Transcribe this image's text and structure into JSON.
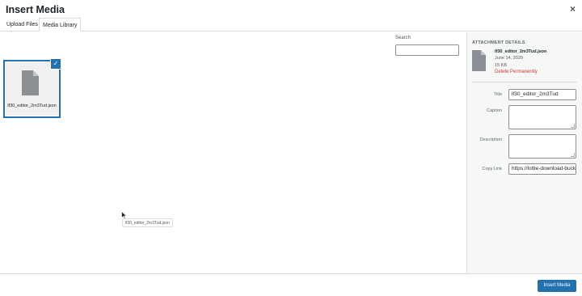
{
  "modal": {
    "title": "Insert Media",
    "close_icon": "×"
  },
  "tabs": [
    {
      "label": "Upload Files"
    },
    {
      "label": "Media Library"
    }
  ],
  "search": {
    "label": "Search",
    "value": "",
    "placeholder": ""
  },
  "library": {
    "items": [
      {
        "filename": "lf30_editor_2m3Tud.json",
        "selected": true,
        "icon": "document-icon"
      }
    ],
    "check_icon": "✓",
    "drag_tooltip": "lf30_editor_2m3Tud.json"
  },
  "details": {
    "heading": "ATTACHMENT DETAILS",
    "filename": "lf30_editor_2m3Tud.json",
    "date": "June 14, 2020",
    "size": "15 KB",
    "delete_label": "Delete Permanently",
    "fields": {
      "title_label": "Title",
      "title_value": "lf30_editor_2m3Tud",
      "caption_label": "Caption",
      "caption_value": "",
      "description_label": "Description",
      "description_value": "",
      "copy_link_label": "Copy Link",
      "copy_link_value": "https://lottie-download-bucket"
    }
  },
  "footer": {
    "insert_label": "Insert Media"
  },
  "colors": {
    "accent": "#2271b1",
    "danger": "#d63638",
    "sidebar_bg": "#f6f7f7"
  }
}
